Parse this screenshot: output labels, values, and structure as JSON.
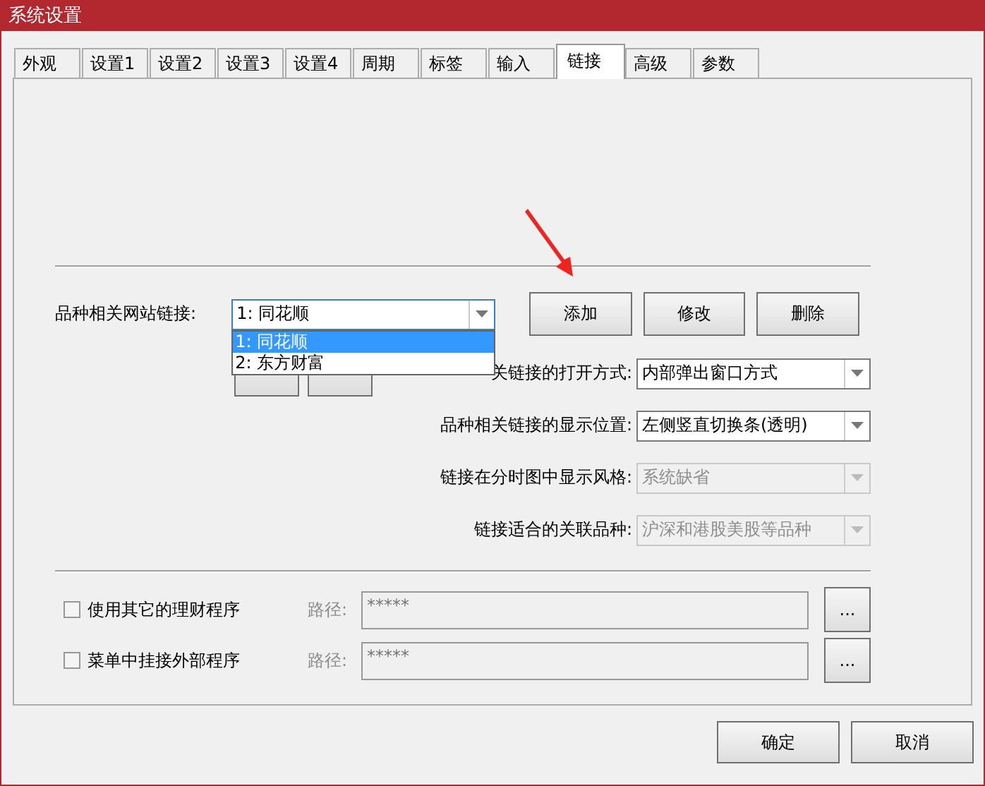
{
  "window": {
    "title": "系统设置"
  },
  "tabs": [
    {
      "label": "外观",
      "selected": false
    },
    {
      "label": "设置1",
      "selected": false
    },
    {
      "label": "设置2",
      "selected": false
    },
    {
      "label": "设置3",
      "selected": false
    },
    {
      "label": "设置4",
      "selected": false
    },
    {
      "label": "周期",
      "selected": false
    },
    {
      "label": "标签",
      "selected": false
    },
    {
      "label": "输入",
      "selected": false
    },
    {
      "label": "链接",
      "selected": true
    },
    {
      "label": "高级",
      "selected": false
    },
    {
      "label": "参数",
      "selected": false
    }
  ],
  "site_link": {
    "label": "品种相关网站链接:",
    "value": "1: 同花顺",
    "expanded": true,
    "options": [
      {
        "label": "1: 同花顺",
        "selected": true
      },
      {
        "label": "2: 东方财富",
        "selected": false
      }
    ]
  },
  "link_buttons": [
    "添加",
    "修改",
    "删除"
  ],
  "settings": [
    {
      "label": "关链接的打开方式:",
      "value": "内部弹出窗口方式",
      "disabled": false
    },
    {
      "label": "品种相关链接的显示位置:",
      "value": "左侧竖直切换条(透明)",
      "disabled": false
    },
    {
      "label": "链接在分时图中显示风格:",
      "value": "系统缺省",
      "disabled": true
    },
    {
      "label": "链接适合的关联品种:",
      "value": "沪深和港股美股等品种",
      "disabled": true
    }
  ],
  "programs": [
    {
      "label": "使用其它的理财程序",
      "checked": false,
      "path_label": "路径:",
      "path": "*****",
      "disabled": true,
      "browse": "..."
    },
    {
      "label": "菜单中挂接外部程序",
      "checked": false,
      "path_label": "路径:",
      "path": "*****",
      "disabled": true,
      "browse": "..."
    }
  ],
  "footer_buttons": [
    "确定",
    "取消"
  ]
}
